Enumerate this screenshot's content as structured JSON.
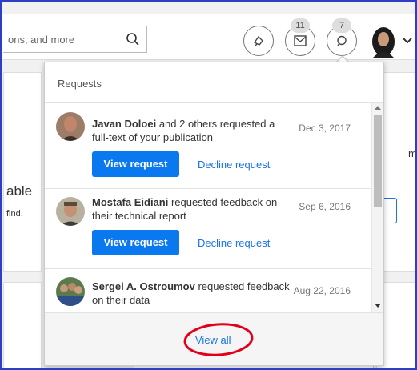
{
  "search": {
    "text": "ons, and more"
  },
  "header": {
    "messages_badge": "11",
    "requests_badge": "7"
  },
  "background": {
    "left_heading_fragment": "able",
    "left_sub_fragment": "find.",
    "right_fragment": "m"
  },
  "requests_panel": {
    "title": "Requests",
    "items": [
      {
        "name": "Javan Doloei",
        "text": " and 2 others requested a full-text of your publication",
        "date": "Dec 3, 2017",
        "view_label": "View request",
        "decline_label": "Decline request"
      },
      {
        "name": "Mostafa Eidiani",
        "text": " requested feedback on their technical report",
        "date": "Sep 6, 2016",
        "view_label": "View request",
        "decline_label": "Decline request"
      },
      {
        "name": "Sergei A. Ostroumov",
        "text": " requested feedback on their data",
        "date": "Aug 22, 2016"
      }
    ],
    "view_all_label": "View all"
  },
  "colors": {
    "primary_button": "#0a79f0",
    "link": "#1a73e8",
    "annotation_red": "#e0001b",
    "frame_border": "#2b3fc7"
  }
}
